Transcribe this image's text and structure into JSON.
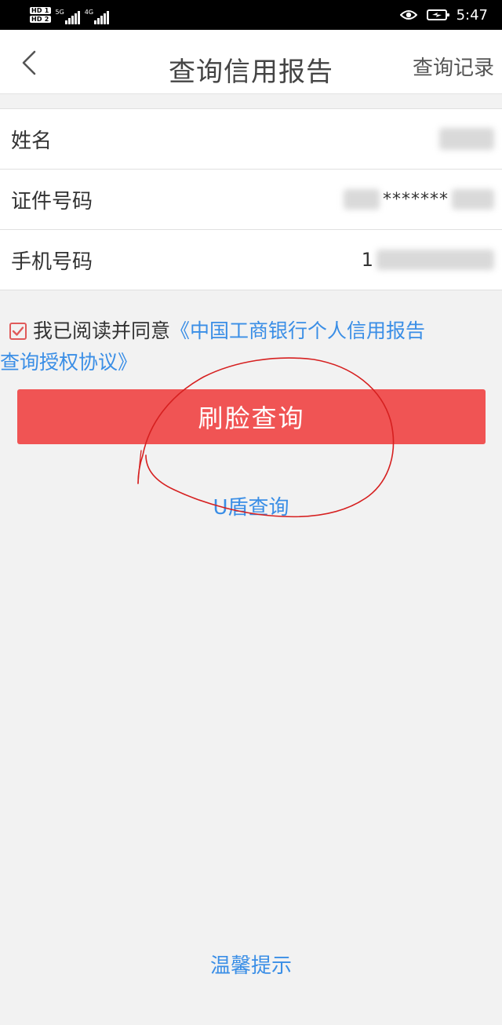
{
  "status_bar": {
    "hd1": "HD 1",
    "hd2": "HD 2",
    "net1": "5G",
    "net2": "4G",
    "time": "5:47"
  },
  "nav": {
    "title": "查询信用报告",
    "right_action": "查询记录"
  },
  "form": {
    "rows": [
      {
        "label": "姓名"
      },
      {
        "label": "证件号码",
        "masked_text": "*******"
      },
      {
        "label": "手机号码",
        "visible_prefix": "1"
      }
    ]
  },
  "agreement": {
    "text": "我已阅读并同意",
    "link_part1": "《中国工商银行个人信用报告",
    "link_part2": "查询授权协议》",
    "checked": true
  },
  "actions": {
    "face_query": "刷脸查询",
    "ukey_query": "U盾查询"
  },
  "footer": {
    "tips": "温馨提示"
  },
  "colors": {
    "primary": "#f05454",
    "link": "#3a8ee6",
    "annotation": "#d62020"
  }
}
